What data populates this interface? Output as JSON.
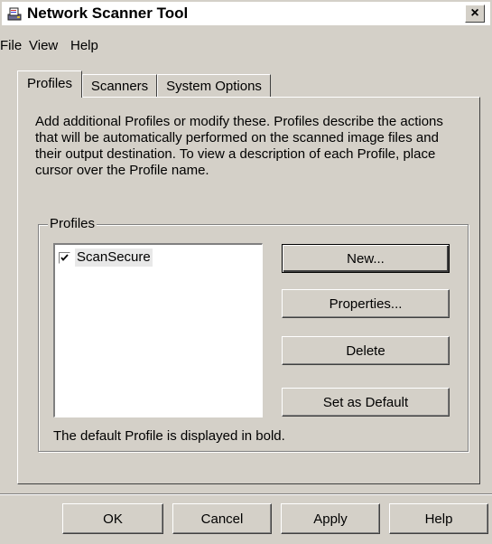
{
  "window": {
    "title": "Network Scanner Tool",
    "close_glyph": "×"
  },
  "menu": {
    "file": "File",
    "view": "View",
    "help": "Help"
  },
  "tabs": [
    {
      "label": "Profiles",
      "active": true
    },
    {
      "label": "Scanners",
      "active": false
    },
    {
      "label": "System Options",
      "active": false
    }
  ],
  "profiles_tab": {
    "description": "Add additional Profiles or modify these. Profiles describe the actions that will be automatically performed on the scanned image files and their output destination. To view a description of each  Profile, place cursor over the Profile name.",
    "group_label": "Profiles",
    "profiles": [
      {
        "name": "ScanSecure",
        "checked": true
      }
    ],
    "buttons": {
      "new": "New...",
      "properties": "Properties...",
      "delete": "Delete",
      "set_default": "Set as Default"
    },
    "footnote": "The default Profile is displayed in bold."
  },
  "dialog_buttons": {
    "ok": "OK",
    "cancel": "Cancel",
    "apply": "Apply",
    "help": "Help"
  },
  "colors": {
    "face": "#d4d0c8",
    "highlight": "#ffffff",
    "shadow": "#808080",
    "dark_shadow": "#404040"
  }
}
